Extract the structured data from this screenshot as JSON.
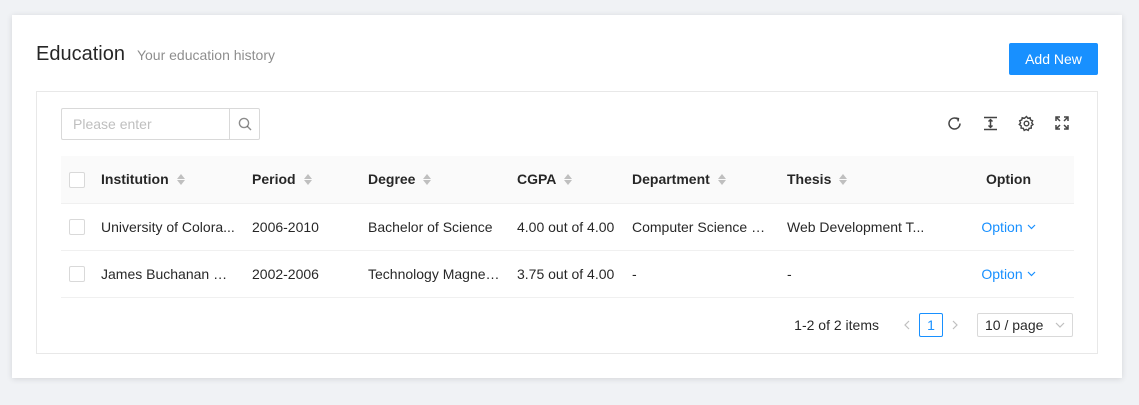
{
  "header": {
    "title": "Education",
    "subtitle": "Your education history",
    "add_label": "Add New"
  },
  "search": {
    "placeholder": "Please enter",
    "value": ""
  },
  "toolbar": {
    "icons": [
      "reload-icon",
      "density-icon",
      "settings-icon",
      "fullscreen-icon"
    ]
  },
  "table": {
    "columns": [
      "Institution",
      "Period",
      "Degree",
      "CGPA",
      "Department",
      "Thesis",
      "Option"
    ],
    "rows": [
      {
        "institution": "University of Colora...",
        "period": "2006-2010",
        "degree": "Bachelor of Science",
        "cgpa": "4.00 out of 4.00",
        "department": "Computer Science &...",
        "thesis": "Web Development T...",
        "option": "Option"
      },
      {
        "institution": "James Buchanan Hi...",
        "period": "2002-2006",
        "degree": "Technology Magnet...",
        "cgpa": "3.75 out of 4.00",
        "department": "-",
        "thesis": "-",
        "option": "Option"
      }
    ]
  },
  "pagination": {
    "total_text": "1-2 of 2 items",
    "current_page": "1",
    "page_size": "10 / page"
  },
  "colors": {
    "primary": "#1890ff",
    "header_bg": "#fafafa",
    "border": "#e8e8e8"
  }
}
